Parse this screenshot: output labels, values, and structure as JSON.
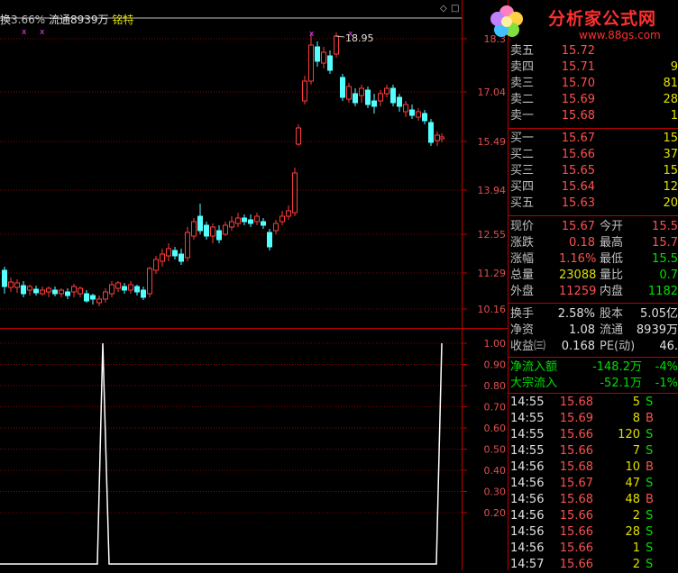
{
  "header": {
    "label_prefix": "换",
    "ratio": "3.66%",
    "float_text": "流通8939万",
    "tag": "铭特",
    "max_marker": "18.95"
  },
  "price_axis": [
    "18.3",
    "17.04",
    "15.49",
    "13.94",
    "12.55",
    "11.29",
    "10.16"
  ],
  "osc_axis": [
    "1.00",
    "0.90",
    "0.80",
    "0.70",
    "0.60",
    "0.50",
    "0.40",
    "0.30",
    "0.20"
  ],
  "logo": {
    "text": "分析家公式网",
    "url": "www.88gs.com"
  },
  "order_book": {
    "asks": [
      {
        "label": "卖五",
        "price": "15.72",
        "vol": ""
      },
      {
        "label": "卖四",
        "price": "15.71",
        "vol": "9"
      },
      {
        "label": "卖三",
        "price": "15.70",
        "vol": "81"
      },
      {
        "label": "卖二",
        "price": "15.69",
        "vol": "28"
      },
      {
        "label": "卖一",
        "price": "15.68",
        "vol": "1"
      }
    ],
    "bids": [
      {
        "label": "买一",
        "price": "15.67",
        "vol": "15"
      },
      {
        "label": "买二",
        "price": "15.66",
        "vol": "37"
      },
      {
        "label": "买三",
        "price": "15.65",
        "vol": "15"
      },
      {
        "label": "买四",
        "price": "15.64",
        "vol": "12"
      },
      {
        "label": "买五",
        "price": "15.63",
        "vol": "20"
      }
    ]
  },
  "quote": {
    "rows": [
      {
        "l1": "现价",
        "v1": "15.67",
        "l2": "今开",
        "v2": "15.5"
      },
      {
        "l1": "涨跌",
        "v1": "0.18",
        "l2": "最高",
        "v2": "15.7"
      },
      {
        "l1": "涨幅",
        "v1": "1.16%",
        "l2": "最低",
        "v2": "15.5"
      },
      {
        "l1": "总量",
        "v1": "23088",
        "l2": "量比",
        "v2": "0.7"
      },
      {
        "l1": "外盘",
        "v1": "11259",
        "l2": "内盘",
        "v2": "1182"
      }
    ]
  },
  "fundamentals": {
    "rows": [
      {
        "l1": "换手",
        "v1": "2.58%",
        "l2": "股本",
        "v2": "5.05亿"
      },
      {
        "l1": "净资",
        "v1": "1.08",
        "l2": "流通",
        "v2": "8939万"
      },
      {
        "l1": "收益㈢",
        "v1": "0.168",
        "l2": "PE(动)",
        "v2": "46."
      }
    ]
  },
  "flows": [
    {
      "label": "净流入额",
      "value": "-148.2万",
      "pct": "-4%"
    },
    {
      "label": "大宗流入",
      "value": "-52.1万",
      "pct": "-1%"
    }
  ],
  "trades": [
    {
      "time": "14:55",
      "price": "15.68",
      "vol": "5",
      "side": "S"
    },
    {
      "time": "14:55",
      "price": "15.69",
      "vol": "8",
      "side": "B"
    },
    {
      "time": "14:55",
      "price": "15.66",
      "vol": "120",
      "side": "S"
    },
    {
      "time": "14:55",
      "price": "15.66",
      "vol": "7",
      "side": "S"
    },
    {
      "time": "14:56",
      "price": "15.68",
      "vol": "10",
      "side": "B"
    },
    {
      "time": "14:56",
      "price": "15.67",
      "vol": "47",
      "side": "S"
    },
    {
      "time": "14:56",
      "price": "15.68",
      "vol": "48",
      "side": "B"
    },
    {
      "time": "14:56",
      "price": "15.66",
      "vol": "2",
      "side": "S"
    },
    {
      "time": "14:56",
      "price": "15.66",
      "vol": "28",
      "side": "S"
    },
    {
      "time": "14:56",
      "price": "15.66",
      "vol": "1",
      "side": "S"
    },
    {
      "time": "14:57",
      "price": "15.66",
      "vol": "2",
      "side": "S"
    }
  ],
  "colors": {
    "up": "#ff3c3c",
    "down": "#54ffff",
    "grid": "#8b0000",
    "border": "#c00000"
  }
}
